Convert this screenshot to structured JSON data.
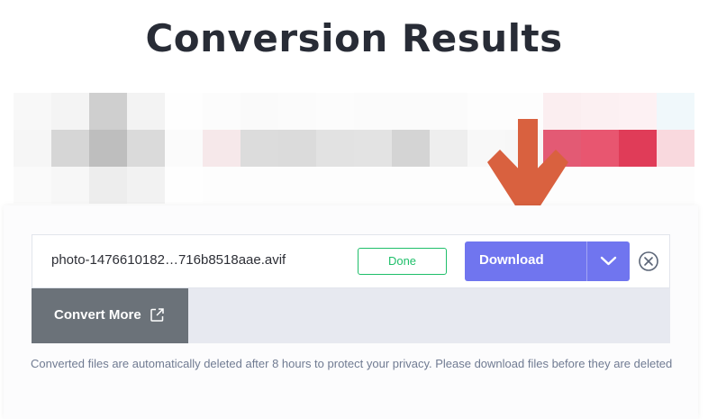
{
  "page": {
    "title": "Conversion Results"
  },
  "preview": {
    "description_colors": [
      [
        "#f8f8f8",
        "#f4f4f4",
        "#cfcfcf",
        "#f3f3f3",
        "#fefefe",
        "#fcfcfc",
        "#fafafa",
        "#fbfbfb",
        "#fcfcfc",
        "#fbfbfb",
        "#fbfbfb",
        "#fbfbfb",
        "#fdfdfd",
        "#fdfdfd",
        "#fbeef0",
        "#fcf0f2",
        "#fdf1f3",
        "#f0f8fb"
      ],
      [
        "#f6f6f6",
        "#d6d6d6",
        "#bebebe",
        "#dadada",
        "#fbfbfb",
        "#f6e8ea",
        "#dcdcdc",
        "#dbdbdb",
        "#e2e2e2",
        "#e3e3e3",
        "#d4d4d4",
        "#eeeeee",
        "#f8f8f8",
        "#f7f7f7",
        "#e35a74",
        "#e85670",
        "#e03c58",
        "#f9d9de"
      ],
      [
        "#fafafa",
        "#f7f7f7",
        "#ededed",
        "#f2f2f2",
        "#fefefe",
        "#fdfdfd",
        "#fdfdfd",
        "#fdfdfd",
        "#fdfdfd",
        "#fdfdfd",
        "#fdfdfd",
        "#fdfdfd",
        "#fdfdfd",
        "#fdfdfd",
        "#fdfdfd",
        "#fdfdfd",
        "#fdfdfd",
        "#fdfdfd"
      ]
    ]
  },
  "result": {
    "filename": "photo-1476610182…716b8518aae.avif",
    "status": "Done",
    "download_label": "Download",
    "convert_more_label": "Convert More",
    "note": "Converted files are automatically deleted after 8 hours to protect your privacy. Please download files before they are deleted"
  },
  "colors": {
    "download": "#7075ef",
    "status": "#1fbf6a",
    "arrow": "#d9613f"
  },
  "icons": [
    "chevron-down-icon",
    "close-circle-icon",
    "external-link-icon",
    "down-arrow-icon"
  ]
}
